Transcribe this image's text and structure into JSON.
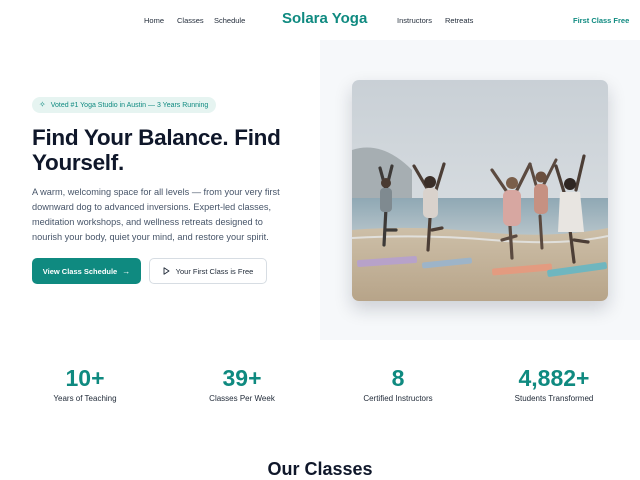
{
  "nav": {
    "links": [
      "Home",
      "Classes",
      "Schedule",
      "Instructors",
      "Retreats"
    ],
    "logo": "Solara Yoga",
    "cta": "First Class Free"
  },
  "hero": {
    "badge": "Voted #1 Yoga Studio in Austin — 3 Years Running",
    "title": "Find Your Balance. Find Yourself.",
    "description": "A warm, welcoming space for all levels — from your very first downward dog to advanced inversions. Expert-led classes, meditation workshops, and wellness retreats designed to nourish your body, quiet your mind, and restore your spirit.",
    "primary_button": "View Class Schedule",
    "secondary_button": "Your First Class is Free"
  },
  "stats": [
    {
      "value": "10+",
      "label": "Years of Teaching"
    },
    {
      "value": "39+",
      "label": "Classes Per Week"
    },
    {
      "value": "8",
      "label": "Certified Instructors"
    },
    {
      "value": "4,882+",
      "label": "Students Transformed"
    }
  ],
  "classes": {
    "title": "Our Classes"
  },
  "colors": {
    "accent": "#0f8a80",
    "badge_bg": "#e6f4f1",
    "text_dark": "#0f172a"
  }
}
